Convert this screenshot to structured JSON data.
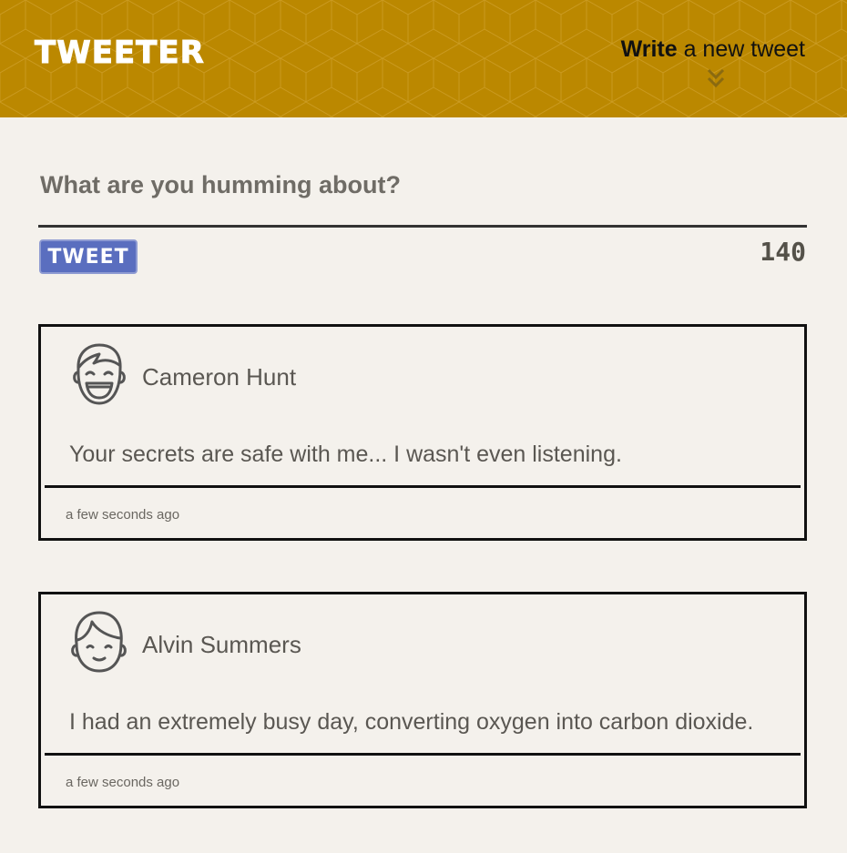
{
  "header": {
    "brand": "TWEETER",
    "write_bold": "Write",
    "write_rest": " a new tweet",
    "chevron_icon": "double-chevron-down-icon",
    "background_color": "#bb8800"
  },
  "compose": {
    "placeholder": "What are you humming about?",
    "button_label": "TWEET",
    "counter": "140",
    "button_color": "#5a6ebf"
  },
  "tweets": [
    {
      "name": "Cameron Hunt",
      "avatar_icon": "laughing-face-avatar-icon",
      "content": "Your secrets are safe with me... I wasn't even listening.",
      "time": "a few seconds ago"
    },
    {
      "name": "Alvin Summers",
      "avatar_icon": "winking-face-avatar-icon",
      "content": "I had an extremely busy day, converting oxygen into carbon dioxide.",
      "time": "a few seconds ago"
    }
  ]
}
